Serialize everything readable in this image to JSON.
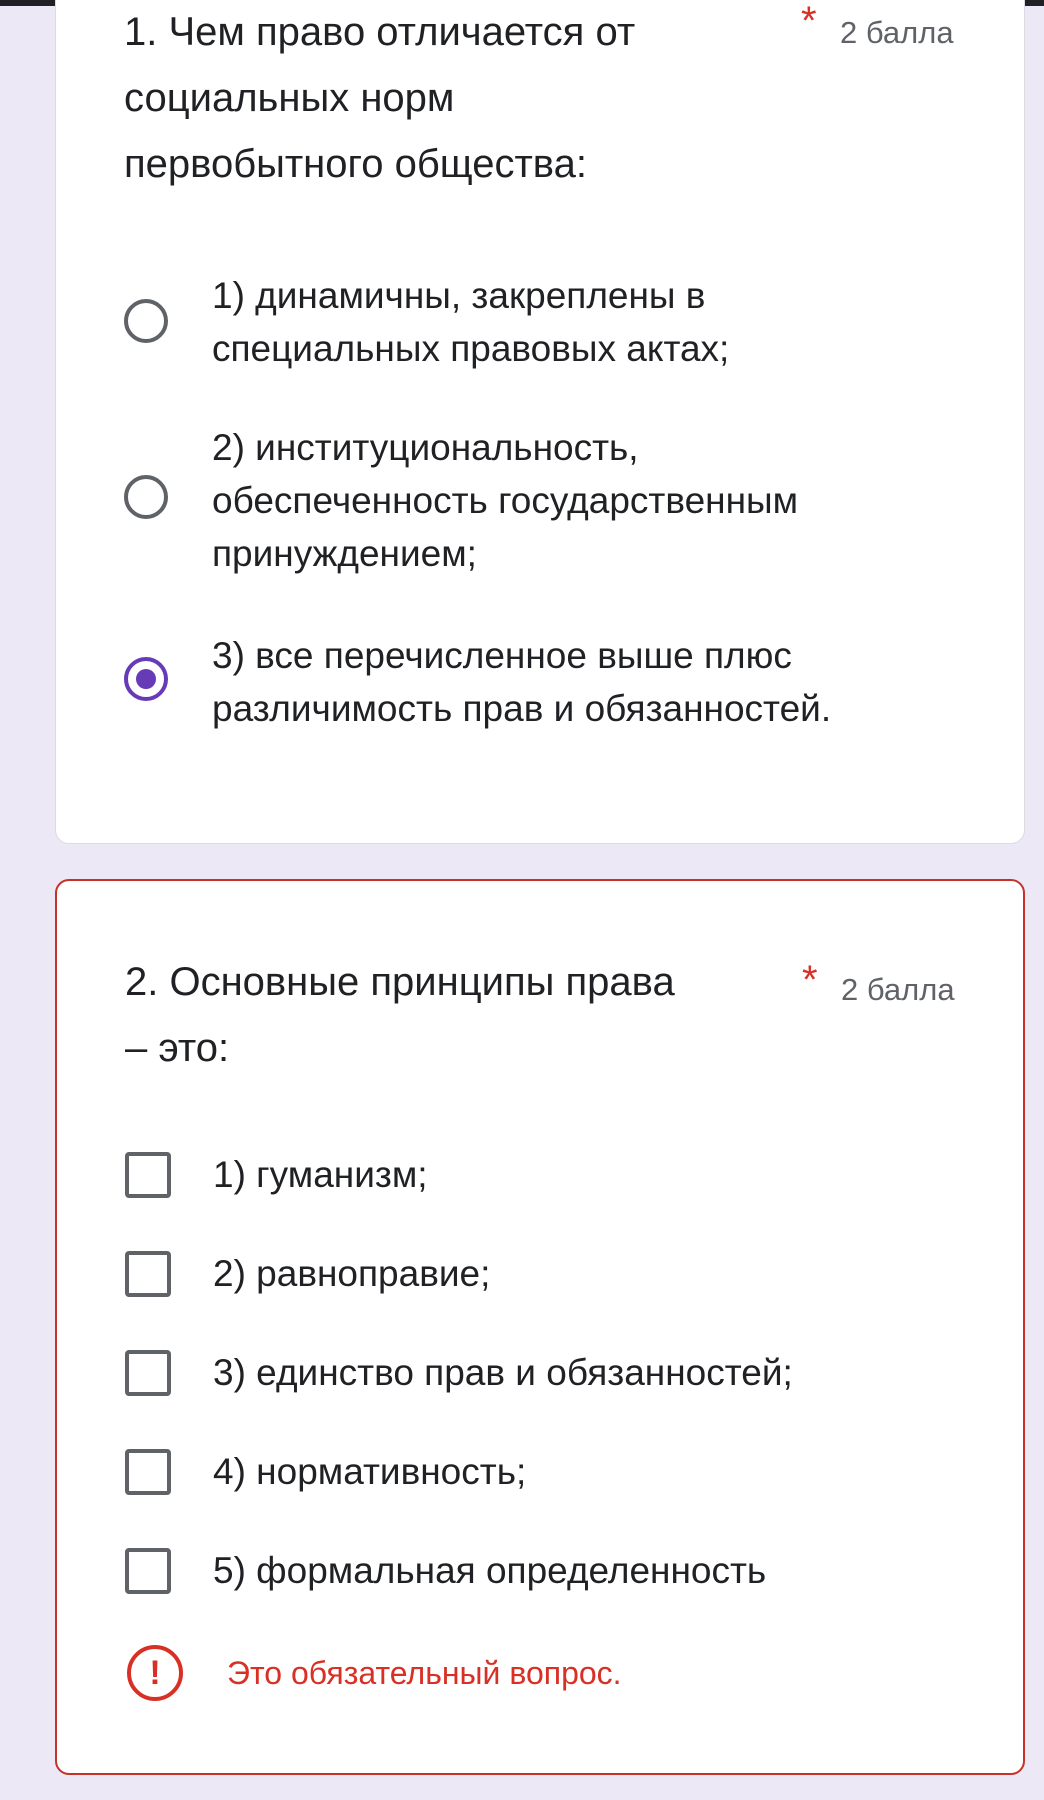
{
  "questions": [
    {
      "title": "1. Чем право отличается от социальных норм первобытного общества:",
      "required_mark": "*",
      "points": "2 балла",
      "type": "radio",
      "options": [
        {
          "label": "1) динамичны, закреплены в специальных правовых актах;",
          "checked": false
        },
        {
          "label": "2) институциональность, обеспеченность государственным принуждением;",
          "checked": false
        },
        {
          "label": "3) все перечисленное выше плюс различимость прав и обязанностей.",
          "checked": true
        }
      ]
    },
    {
      "title": "2. Основные принципы права – это:",
      "required_mark": "*",
      "points": "2 балла",
      "type": "checkbox",
      "options": [
        {
          "label": "1) гуманизм;",
          "checked": false
        },
        {
          "label": "2) равноправие;",
          "checked": false
        },
        {
          "label": "3) единство прав и обязанностей;",
          "checked": false
        },
        {
          "label": "4) нормативность;",
          "checked": false
        },
        {
          "label": "5) формальная определенность",
          "checked": false
        }
      ],
      "error_icon": "!",
      "error_text": "Это обязательный вопрос."
    }
  ],
  "colors": {
    "background": "#ece8f6",
    "accent": "#673ab7",
    "error": "#d93025"
  }
}
